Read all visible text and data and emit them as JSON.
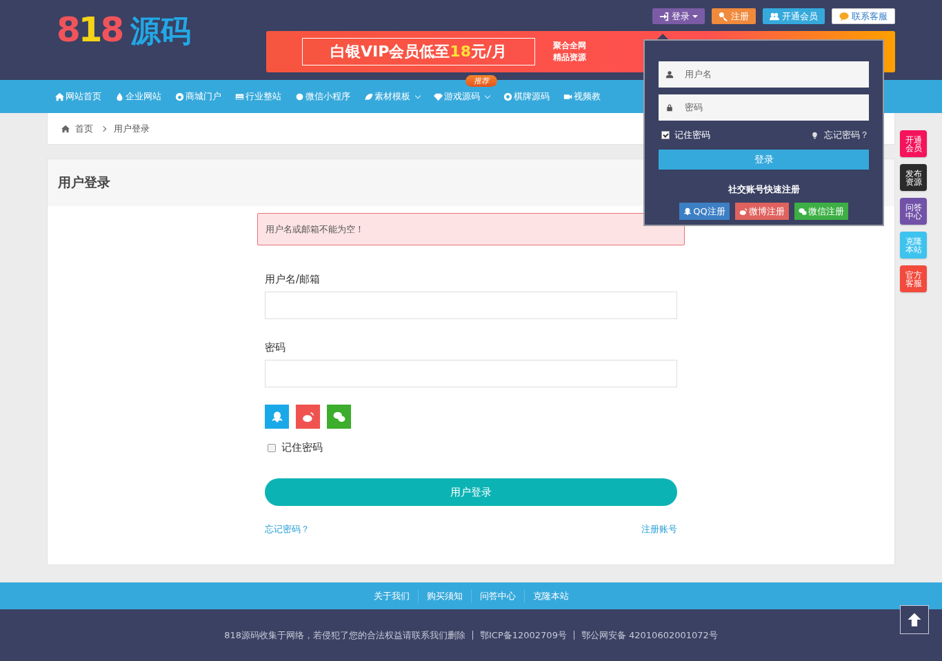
{
  "logo": {
    "parts": [
      {
        "text": "8",
        "color": "#f0545a"
      },
      {
        "text": "1",
        "color": "#f5d418"
      },
      {
        "text": "8",
        "color": "#f0545a"
      },
      {
        "text": "源码",
        "color": "#23a8e6"
      }
    ]
  },
  "top_buttons": [
    {
      "label": "登录",
      "kind": "login",
      "color": "#7b5ba6"
    },
    {
      "label": "注册",
      "kind": "register",
      "color": "#f08a3c"
    },
    {
      "label": "开通会员",
      "kind": "member",
      "color": "#36a9dc"
    },
    {
      "label": "联系客服",
      "kind": "service",
      "color": "#ffffff"
    }
  ],
  "banner": {
    "text": "白银VIP会员低至",
    "highlight": "18",
    "unit": "元/月",
    "side": [
      "聚合全网",
      "精品资源"
    ]
  },
  "nav": [
    {
      "label": "网站首页",
      "kind": "home",
      "caret": false
    },
    {
      "label": "企业网站",
      "kind": "drop",
      "caret": false
    },
    {
      "label": "商城门户",
      "kind": "cat",
      "caret": false
    },
    {
      "label": "行业整站",
      "kind": "card",
      "caret": false
    },
    {
      "label": "微信小程序",
      "kind": "circle",
      "caret": false
    },
    {
      "label": "素材模板",
      "kind": "leaf",
      "caret": true
    },
    {
      "label": "游戏源码",
      "kind": "diamond",
      "caret": true,
      "badge": "推荐"
    },
    {
      "label": "棋牌源码",
      "kind": "wheel",
      "caret": false
    },
    {
      "label": "视频教",
      "kind": "video",
      "caret": false
    }
  ],
  "breadcrumb": [
    "首页",
    "用户登录"
  ],
  "login": {
    "title": "用户登录",
    "error": "用户名或邮箱不能为空！",
    "fields": [
      {
        "label": "用户名/邮箱"
      },
      {
        "label": "密码"
      }
    ],
    "social": [
      {
        "kind": "qq",
        "color": "#1aa9e8"
      },
      {
        "kind": "weibo",
        "color": "#f05250"
      },
      {
        "kind": "wechat",
        "color": "#3cad2c"
      }
    ],
    "remember": {
      "label": "记住密码",
      "checked": false
    },
    "submit": "用户登录",
    "forgot": "忘记密码？",
    "register": "注册账号"
  },
  "dropdown": {
    "fields": [
      {
        "placeholder": "用户名",
        "kind": "user"
      },
      {
        "placeholder": "密码",
        "kind": "lock"
      }
    ],
    "remember": {
      "label": "记住密码",
      "checked": true
    },
    "forgot": "忘记密码？",
    "submit": "登录",
    "social_title": "社交账号快速注册",
    "social": [
      {
        "label": "QQ注册",
        "kind": "qq",
        "color": "#3d7fc4"
      },
      {
        "label": "微博注册",
        "kind": "weibo",
        "color": "#e0625e"
      },
      {
        "label": "微信注册",
        "kind": "wechat",
        "color": "#3daf44"
      }
    ]
  },
  "side_buttons": [
    {
      "label": "开通会员",
      "color": "#f5135c"
    },
    {
      "label": "发布资源",
      "color": "#2b2b2b"
    },
    {
      "label": "问答中心",
      "color": "#7152a8"
    },
    {
      "label": "克隆本站",
      "color": "#3ec3ef"
    },
    {
      "label": "官方客服",
      "color": "#f24b3e"
    }
  ],
  "footer": {
    "links": [
      "关于我们",
      "购买须知",
      "问答中心",
      "克隆本站"
    ],
    "notice": "818源码收集于网络，若侵犯了您的合法权益请联系我们删除",
    "icp": "鄂ICP备12002709号",
    "police": "鄂公网安备 42010602001072号"
  }
}
